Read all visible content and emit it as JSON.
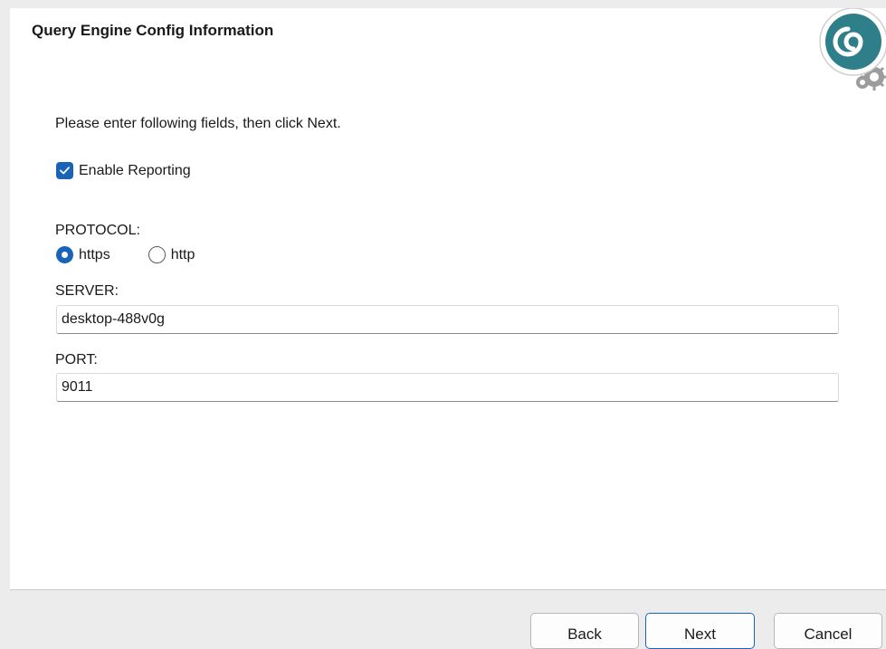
{
  "header": {
    "title": "Query Engine Config Information"
  },
  "instructions": "Please enter following fields, then click Next.",
  "reporting": {
    "label": "Enable Reporting",
    "checked": true
  },
  "protocol": {
    "label": "PROTOCOL:",
    "options": [
      {
        "label": "https",
        "selected": true
      },
      {
        "label": "http",
        "selected": false
      }
    ]
  },
  "server": {
    "label": "SERVER:",
    "value": "desktop-488v0g"
  },
  "port": {
    "label": "PORT:",
    "value": "9011"
  },
  "footer": {
    "back_label": "Back",
    "next_label": "Next",
    "cancel_label": "Cancel"
  },
  "colors": {
    "accent": "#1a64b8",
    "logo_teal": "#2f7f8b"
  },
  "icons": {
    "logo": "spiral-gears-logo-icon",
    "checkbox": "checkmark-icon"
  }
}
